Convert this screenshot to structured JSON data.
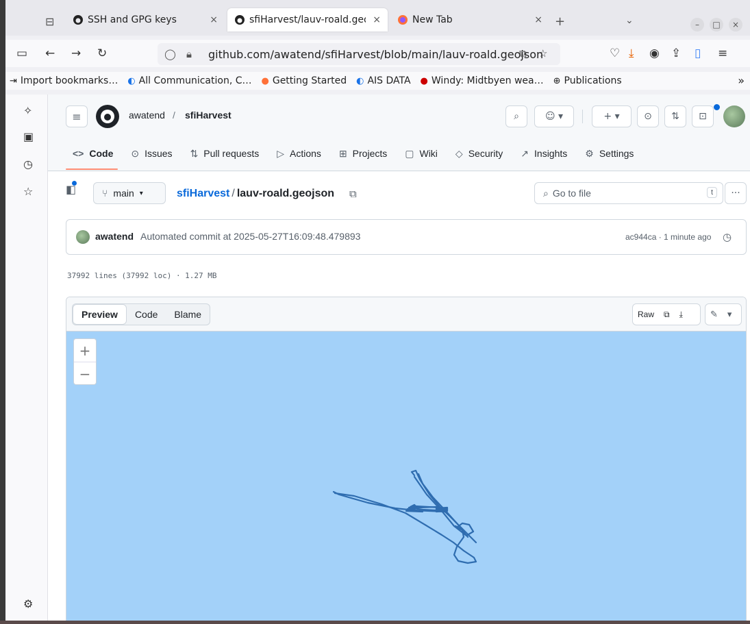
{
  "browser": {
    "tabs": [
      {
        "title": "SSH and GPG keys",
        "close": "×"
      },
      {
        "title": "sfiHarvest/lauv-roald.geo",
        "close": "×"
      },
      {
        "title": "New Tab",
        "close": "×"
      }
    ],
    "new_tab": "+",
    "url": "github.com/awatend/sfiHarvest/blob/main/lauv-roald.geojson",
    "bookmarks": [
      "Import bookmarks…",
      "All Communication, C…",
      "Getting Started",
      "AIS DATA",
      "Windy: Midtbyen wea…",
      "Publications"
    ],
    "bookmarks_overflow": "»"
  },
  "repo": {
    "owner": "awatend",
    "sep": "/",
    "name": "sfiHarvest",
    "nav": [
      {
        "label": "Code",
        "icon": "code-icon"
      },
      {
        "label": "Issues",
        "icon": "issue-icon"
      },
      {
        "label": "Pull requests",
        "icon": "pull-request-icon"
      },
      {
        "label": "Actions",
        "icon": "play-icon"
      },
      {
        "label": "Projects",
        "icon": "table-icon"
      },
      {
        "label": "Wiki",
        "icon": "book-icon"
      },
      {
        "label": "Security",
        "icon": "shield-icon"
      },
      {
        "label": "Insights",
        "icon": "graph-icon"
      },
      {
        "label": "Settings",
        "icon": "gear-icon"
      }
    ]
  },
  "file": {
    "branch": "main",
    "repo_link": "sfiHarvest",
    "sep": "/",
    "filename": "lauv-roald.geojson",
    "goto_placeholder": "Go to file",
    "goto_key": "t",
    "commit": {
      "author": "awatend",
      "message": "Automated commit at 2025-05-27T16:09:48.479893",
      "meta": "ac944ca · 1 minute ago"
    },
    "info": "37992 lines (37992 loc) · 1.27 MB",
    "view_tabs": [
      "Preview",
      "Code",
      "Blame"
    ],
    "raw_label": "Raw"
  },
  "map": {
    "zoom_in": "+",
    "zoom_out": "−",
    "track_color": "#2f6db0",
    "water_color": "#a3d1f9"
  },
  "colors": {
    "accent": "#0969da",
    "underline": "#fd8c73"
  }
}
